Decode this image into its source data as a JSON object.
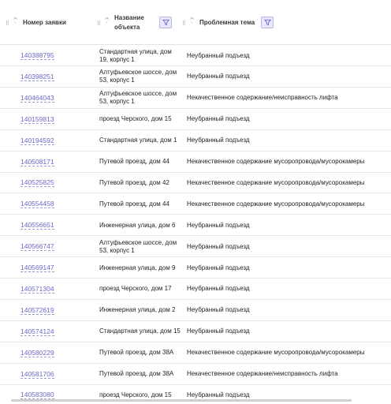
{
  "header": {
    "col_id": "Номер заявки",
    "col_object": "Название объекта",
    "col_topic": "Проблемная тема"
  },
  "rows": [
    {
      "id": "140388795",
      "object": "Стандартная улица, дом 19, корпус 1",
      "topic": "Неубранный подъезд"
    },
    {
      "id": "140398251",
      "object": "Алтуфьевское шоссе, дом 53, корпус 1",
      "topic": "Неубранный подъезд"
    },
    {
      "id": "140464043",
      "object": "Алтуфьевское шоссе, дом 53, корпус 1",
      "topic": "Некачественное содержание/неисправность лифта"
    },
    {
      "id": "140159813",
      "object": "проезд Черского, дом 15",
      "topic": "Неубранный подъезд"
    },
    {
      "id": "140194592",
      "object": "Стандартная улица, дом 1",
      "topic": "Неубранный подъезд"
    },
    {
      "id": "140508171",
      "object": "Путевой проезд, дом 44",
      "topic": "Некачественное содержание мусоропровода/мусорокамеры"
    },
    {
      "id": "140525825",
      "object": "Путевой проезд, дом 42",
      "topic": "Некачественное содержание мусоропровода/мусорокамеры"
    },
    {
      "id": "140554458",
      "object": "Путевой проезд, дом 44",
      "topic": "Некачественное содержание мусоропровода/мусорокамеры"
    },
    {
      "id": "140556651",
      "object": "Инженерная улица, дом 6",
      "topic": "Неубранный подъезд"
    },
    {
      "id": "140566747",
      "object": "Алтуфьевское шоссе, дом 53, корпус 1",
      "topic": "Неубранный подъезд"
    },
    {
      "id": "140569147",
      "object": "Инженерная улица, дом 9",
      "topic": "Неубранный подъезд"
    },
    {
      "id": "140571304",
      "object": "проезд Черского, дом 17",
      "topic": "Неубранный подъезд"
    },
    {
      "id": "140572619",
      "object": "Инженерная улица, дом 2",
      "topic": "Неубранный подъезд"
    },
    {
      "id": "140574124",
      "object": "Стандартная улица, дом 15",
      "topic": "Неубранный подъезд"
    },
    {
      "id": "140580229",
      "object": "Путевой проезд, дом 38А",
      "topic": "Некачественное содержание мусоропровода/мусорокамеры"
    },
    {
      "id": "140581706",
      "object": "Путевой проезд, дом 38А",
      "topic": "Некачественное содержание/неисправность лифта"
    },
    {
      "id": "140583080",
      "object": "проезд Черского, дом 15",
      "topic": "Неубранный подъезд"
    }
  ],
  "colors": {
    "link": "#6a68c8",
    "filter_bg": "#e9e8fb",
    "filter_icon": "#6d66cf"
  },
  "icons": {
    "sort": "sort-arrows-icon",
    "filter": "funnel-filter-icon",
    "drag": "drag-handle-icon"
  }
}
